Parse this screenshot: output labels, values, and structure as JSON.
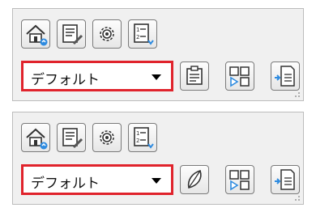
{
  "colors": {
    "highlight_border": "#e0232c",
    "panel_bg": "#f0f0f0"
  },
  "panels": [
    {
      "toolbar": [
        "home-icon",
        "properties-edit-icon",
        "gear-icon",
        "numbered-list-icon"
      ],
      "dropdown": {
        "value": "デフォルト"
      },
      "actions": [
        "clipboard-icon",
        "layout-switch-icon",
        "import-page-icon"
      ]
    },
    {
      "toolbar": [
        "home-icon",
        "properties-edit-icon",
        "gear-icon",
        "numbered-list-icon"
      ],
      "dropdown": {
        "value": "デフォルト"
      },
      "actions": [
        "leaf-icon",
        "layout-switch-icon",
        "import-page-icon"
      ]
    }
  ]
}
